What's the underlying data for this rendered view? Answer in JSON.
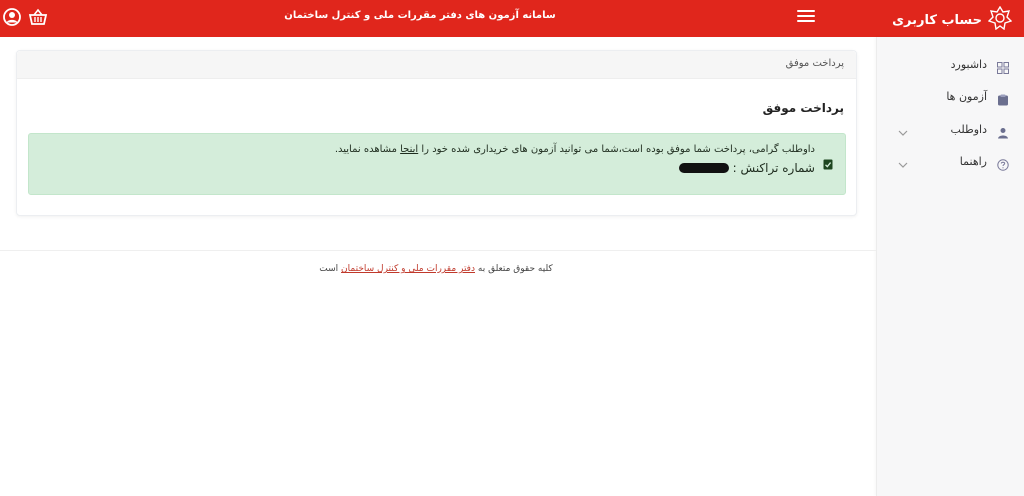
{
  "header": {
    "site_title": "سامانه آزمون های دفتر مقررات ملی و کنترل ساختمان",
    "brand": "حساب کاربری",
    "accent_color": "#e0261c",
    "icons": [
      "user-circle-icon",
      "basket-icon",
      "hamburger-menu-icon",
      "brand-logo-icon"
    ]
  },
  "sidebar": {
    "items": [
      {
        "label": "داشبورد",
        "icon": "grid-icon",
        "has_submenu": false
      },
      {
        "label": "آزمون ها",
        "icon": "clipboard-icon",
        "has_submenu": false
      },
      {
        "label": "داوطلب",
        "icon": "user-icon",
        "has_submenu": true
      },
      {
        "label": "راهنما",
        "icon": "help-circle-icon",
        "has_submenu": true
      }
    ]
  },
  "main": {
    "card_header": "پرداخت موفق",
    "title": "پرداخت موفق",
    "alert": {
      "message_before_link": "داوطلب گرامی، پرداخت شما موفق بوده است،شما می توانید آزمون های خریداری شده خود را",
      "link_text": "اینجا",
      "message_after_link": "مشاهده نمایید.",
      "transaction_label": "شماره تراکنش :",
      "icon": "check-square-icon",
      "bg_color": "#d4edda"
    }
  },
  "footer": {
    "text_before": "کلیه حقوق متعلق به",
    "link_text": "دفتر مقررات ملی و کنترل ساختمان",
    "text_after": "است"
  }
}
